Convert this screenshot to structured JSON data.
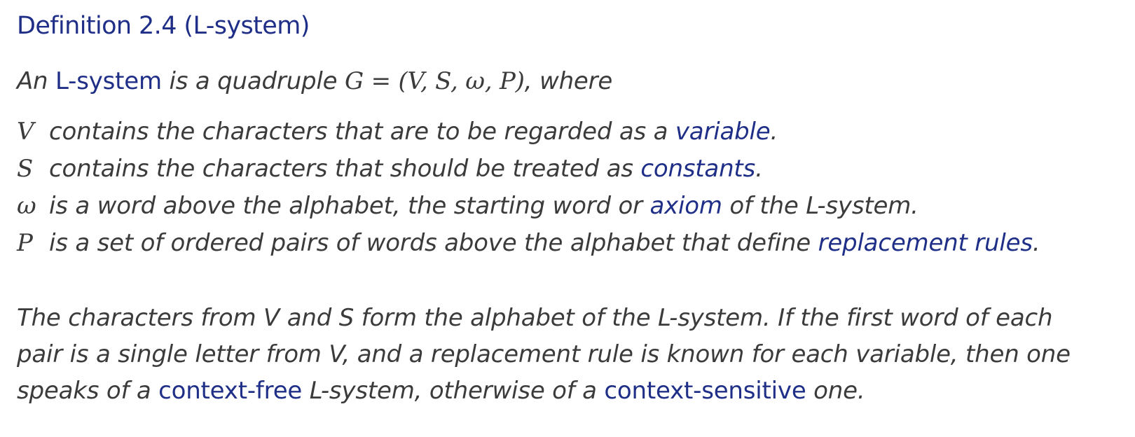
{
  "definition": {
    "title": "Definition 2.4 (L-system)",
    "intro": {
      "prefix": "An ",
      "keyword": "L-system",
      "middle": " is a quadruple ",
      "formula": "G = (V, S, ω, P)",
      "suffix": ", where"
    },
    "items": [
      {
        "symbol": "V",
        "text": "contains the characters that are to be regarded as a ",
        "keyword": "variable",
        "after": "."
      },
      {
        "symbol": "S",
        "text": "contains the characters that should be treated as ",
        "keyword": "constants",
        "after": "."
      },
      {
        "symbol": "ω",
        "text": "is a word above the alphabet, the starting word or ",
        "keyword": "axiom",
        "after": " of the L-system."
      },
      {
        "symbol": "P",
        "text": "is a set of ordered pairs of words above the alphabet that define ",
        "keyword": "replacement rules",
        "after": "."
      }
    ],
    "paragraph": {
      "line1": "The characters from V and S form the alphabet of the L-system. If the first word of each",
      "line2": "pair is a single letter from V, and a replacement rule is known for each variable, then one",
      "line3_prefix": "speaks of a ",
      "keyword1": "context-free",
      "line3_middle": " L-system, otherwise of a ",
      "keyword2": "context-sensitive",
      "line3_suffix": " one."
    },
    "colors": {
      "keyword": "#1f2f88",
      "text": "#3b3b3b"
    }
  }
}
